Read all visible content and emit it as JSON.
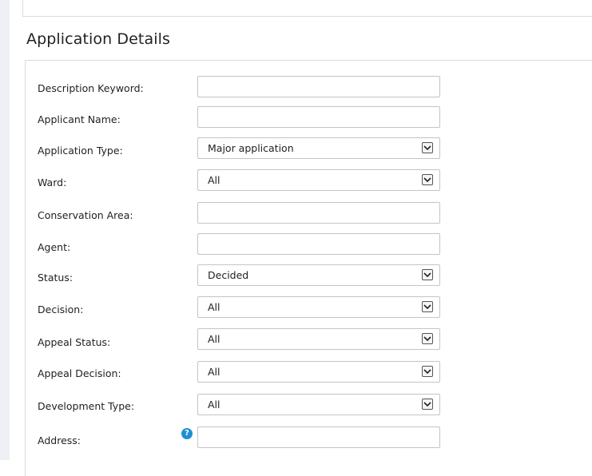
{
  "section": {
    "title": "Application Details"
  },
  "fields": [
    {
      "label": "Description Keyword:",
      "type": "text",
      "value": ""
    },
    {
      "label": "Applicant Name:",
      "type": "text",
      "value": ""
    },
    {
      "label": "Application Type:",
      "type": "select",
      "value": "Major application"
    },
    {
      "label": "Ward:",
      "type": "select",
      "value": "All"
    },
    {
      "label": "Conservation Area:",
      "type": "text",
      "value": ""
    },
    {
      "label": "Agent:",
      "type": "text",
      "value": ""
    },
    {
      "label": "Status:",
      "type": "select",
      "value": "Decided"
    },
    {
      "label": "Decision:",
      "type": "select",
      "value": "All"
    },
    {
      "label": "Appeal Status:",
      "type": "select",
      "value": "All"
    },
    {
      "label": "Appeal Decision:",
      "type": "select",
      "value": "All"
    },
    {
      "label": "Development Type:",
      "type": "select",
      "value": "All"
    },
    {
      "label": "Address:",
      "type": "text",
      "value": ""
    }
  ],
  "help": {
    "glyph": "?",
    "color": "#1e8fd6",
    "icon": "help-icon"
  }
}
